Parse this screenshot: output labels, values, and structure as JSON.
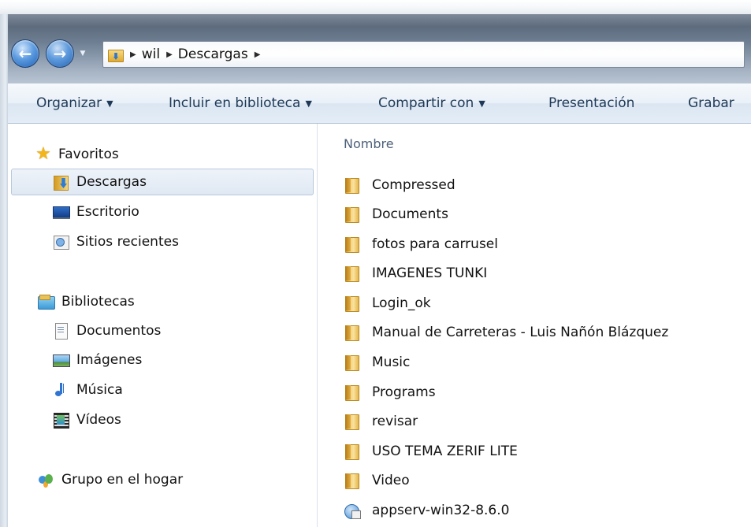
{
  "address_bar": {
    "path": [
      "wil",
      "Descargas"
    ]
  },
  "command_bar": {
    "organize": "Organizar",
    "include_library": "Incluir en biblioteca",
    "share_with": "Compartir con",
    "slideshow": "Presentación",
    "burn": "Grabar"
  },
  "nav_pane": {
    "favorites": {
      "label": "Favoritos",
      "items": [
        {
          "label": "Descargas",
          "icon": "downloads-folder-icon"
        },
        {
          "label": "Escritorio",
          "icon": "desktop-icon"
        },
        {
          "label": "Sitios recientes",
          "icon": "recent-places-icon"
        }
      ]
    },
    "libraries": {
      "label": "Bibliotecas",
      "items": [
        {
          "label": "Documentos",
          "icon": "documents-icon"
        },
        {
          "label": "Imágenes",
          "icon": "pictures-icon"
        },
        {
          "label": "Música",
          "icon": "music-icon"
        },
        {
          "label": "Vídeos",
          "icon": "videos-icon"
        }
      ]
    },
    "homegroup": {
      "label": "Grupo en el hogar"
    }
  },
  "file_list": {
    "column_name": "Nombre",
    "items": [
      {
        "name": "Compressed",
        "type": "folder"
      },
      {
        "name": "Documents",
        "type": "folder"
      },
      {
        "name": "fotos para carrusel",
        "type": "folder"
      },
      {
        "name": "IMAGENES TUNKI",
        "type": "folder"
      },
      {
        "name": "Login_ok",
        "type": "folder"
      },
      {
        "name": "Manual de Carreteras - Luis Nañón Blázquez",
        "type": "folder"
      },
      {
        "name": "Music",
        "type": "folder"
      },
      {
        "name": "Programs",
        "type": "folder"
      },
      {
        "name": "revisar",
        "type": "folder"
      },
      {
        "name": "USO TEMA ZERIF LITE",
        "type": "folder"
      },
      {
        "name": "Video",
        "type": "folder"
      },
      {
        "name": "appserv-win32-8.6.0",
        "type": "setup"
      }
    ]
  }
}
